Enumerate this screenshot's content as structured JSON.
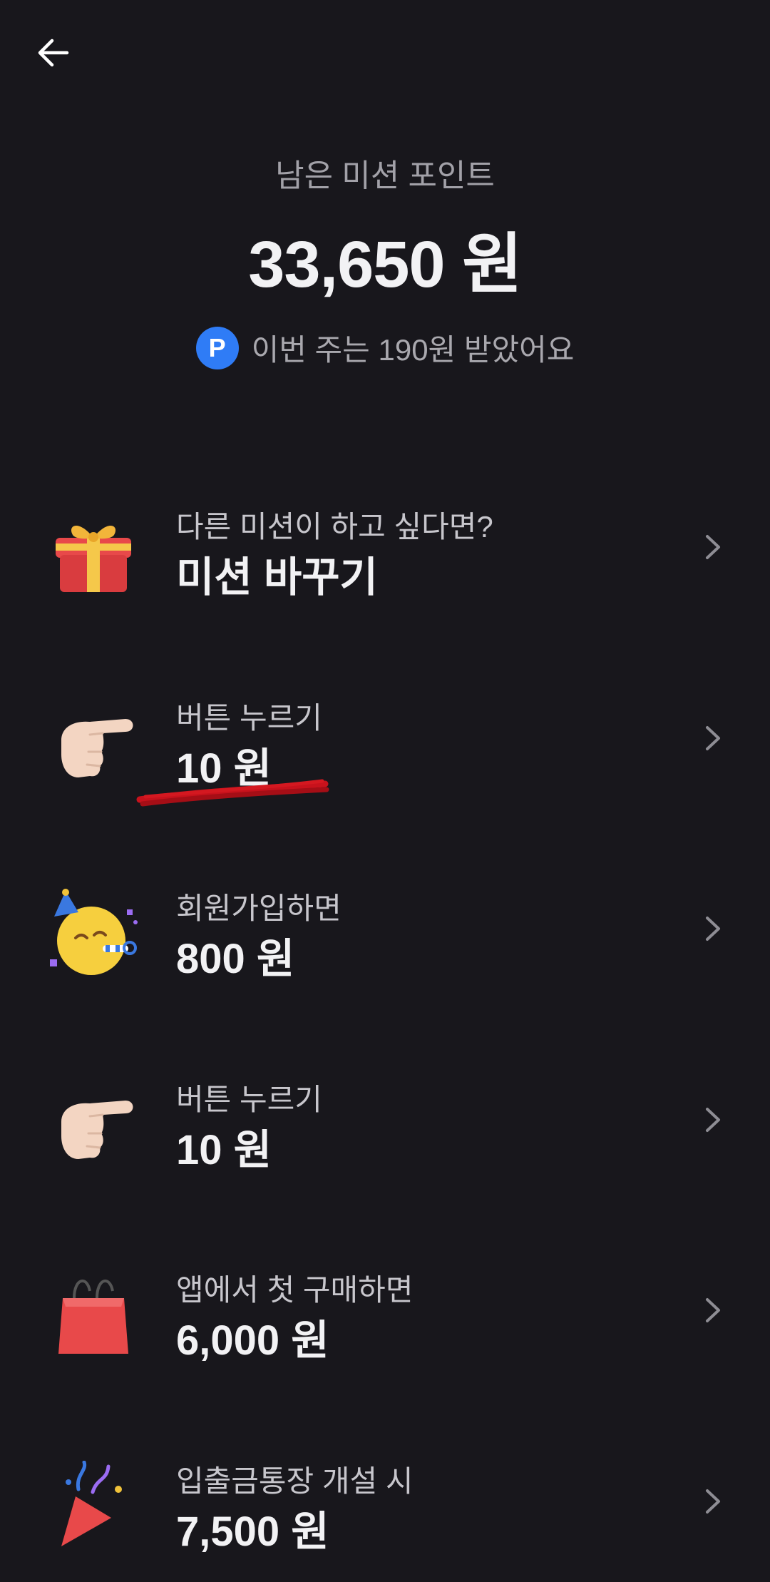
{
  "header": {
    "remaining_label": "남은 미션 포인트",
    "remaining_amount": "33,650 원",
    "weekly_badge": "P",
    "weekly_text": "이번 주는 190원 받았어요"
  },
  "missions": [
    {
      "icon": "gift-icon",
      "label": "다른 미션이 하고 싶다면?",
      "value": "미션 바꾸기"
    },
    {
      "icon": "pointing-hand-icon",
      "label": "버튼 누르기",
      "value": "10 원"
    },
    {
      "icon": "party-face-icon",
      "label": "회원가입하면",
      "value": "800 원"
    },
    {
      "icon": "pointing-hand-icon",
      "label": "버튼 누르기",
      "value": "10 원"
    },
    {
      "icon": "shopping-bag-icon",
      "label": "앱에서 첫 구매하면",
      "value": "6,000 원"
    },
    {
      "icon": "party-popper-icon",
      "label": "입출금통장 개설 시",
      "value": "7,500 원"
    }
  ],
  "colors": {
    "background": "#18171c",
    "accent_blue": "#2f7cf6",
    "annotation_red": "#c8121c"
  }
}
